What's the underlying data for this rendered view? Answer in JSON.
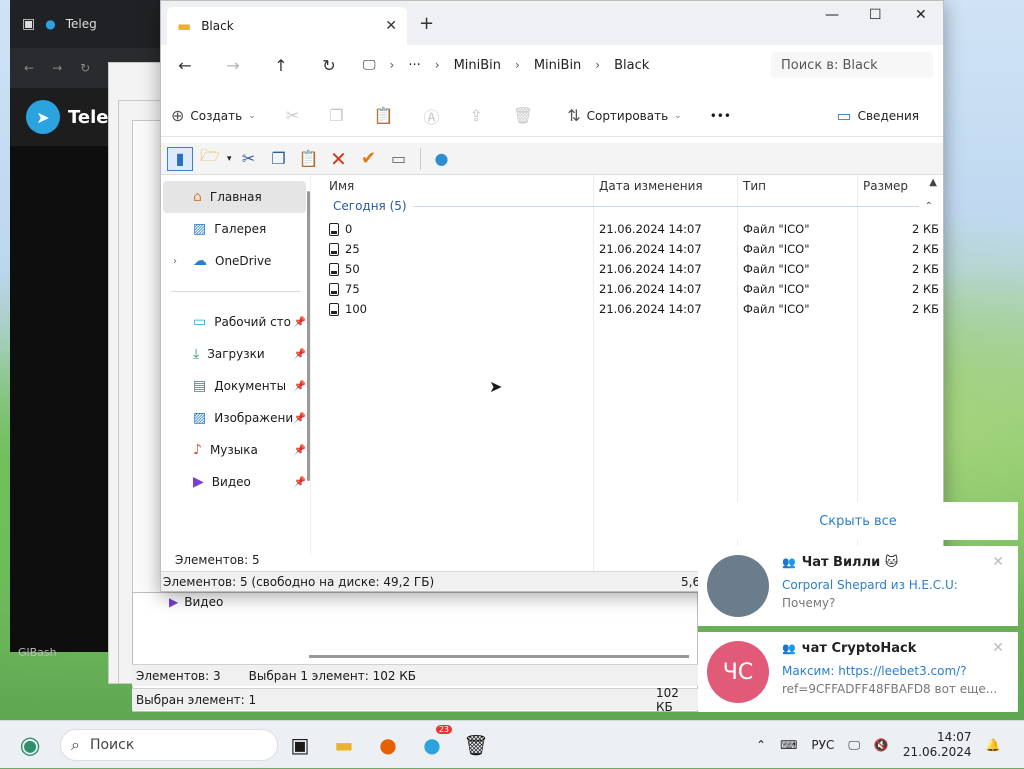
{
  "explorer": {
    "tab_title": "Black",
    "close_tab": "✕",
    "new_tab": "+",
    "breadcrumb": [
      "MiniBin",
      "MiniBin",
      "Black"
    ],
    "search_placeholder": "Поиск в: Black",
    "cmd": {
      "create": "Создать",
      "sort": "Сортировать",
      "more": "•••",
      "details": "Сведения"
    },
    "nav_pane": [
      {
        "label": "Главная",
        "icon": "home-icon",
        "selected": true
      },
      {
        "label": "Галерея",
        "icon": "gallery-icon"
      },
      {
        "label": "OneDrive",
        "icon": "cloud-icon",
        "expandable": true
      },
      {
        "label": "Рабочий сто",
        "icon": "desktop-icon",
        "pinned": true
      },
      {
        "label": "Загрузки",
        "icon": "download-icon",
        "pinned": true
      },
      {
        "label": "Документы",
        "icon": "documents-icon",
        "pinned": true
      },
      {
        "label": "Изображени",
        "icon": "pictures-icon",
        "pinned": true
      },
      {
        "label": "Музыка",
        "icon": "music-icon",
        "pinned": true
      },
      {
        "label": "Видео",
        "icon": "video-icon",
        "pinned": true
      }
    ],
    "columns": {
      "name": "Имя",
      "date": "Дата изменения",
      "type": "Тип",
      "size": "Размер"
    },
    "group_label": "Сегодня (5)",
    "files": [
      {
        "name": "0",
        "date": "21.06.2024 14:07",
        "type": "Файл \"ICO\"",
        "size": "2 КБ"
      },
      {
        "name": "25",
        "date": "21.06.2024 14:07",
        "type": "Файл \"ICO\"",
        "size": "2 КБ"
      },
      {
        "name": "50",
        "date": "21.06.2024 14:07",
        "type": "Файл \"ICO\"",
        "size": "2 КБ"
      },
      {
        "name": "75",
        "date": "21.06.2024 14:07",
        "type": "Файл \"ICO\"",
        "size": "2 КБ"
      },
      {
        "name": "100",
        "date": "21.06.2024 14:07",
        "type": "Файл \"ICO\"",
        "size": "2 КБ"
      }
    ],
    "items_count": "Элементов: 5",
    "status_left": "Элементов: 5 (свободно на диске: 49,2 ГБ)",
    "status_right": "5,6"
  },
  "background_window": {
    "nav_item": "Видео",
    "status_items": "Элементов: 3",
    "status_selected": "Выбран 1 элемент: 102 КБ",
    "status_bottom": "Выбран элемент: 1",
    "status_bottom_size": "102 КБ"
  },
  "telegram_bg": {
    "tab_title": "Teleg",
    "header": "Tele",
    "footer_text": "GlBash"
  },
  "notifications": {
    "hide_all": "Скрыть все",
    "items": [
      {
        "title": "Чат Вилли 🐱",
        "sender_line": "Corporal Shepard из H.E.C.U:",
        "message": "Почему?",
        "avatar_color": "#6b7c8c",
        "avatar_text": ""
      },
      {
        "title": "чат CryptoHack",
        "sender_line": "Максим: https://leebet3.com/?",
        "message": "ref=9CFFADFF48FBAFD8 вот еще...",
        "avatar_color": "#e15b78",
        "avatar_text": "ЧС"
      }
    ]
  },
  "taskbar": {
    "search_placeholder": "Поиск",
    "telegram_badge": "23",
    "language": "РУС",
    "time": "14:07",
    "date": "21.06.2024"
  }
}
